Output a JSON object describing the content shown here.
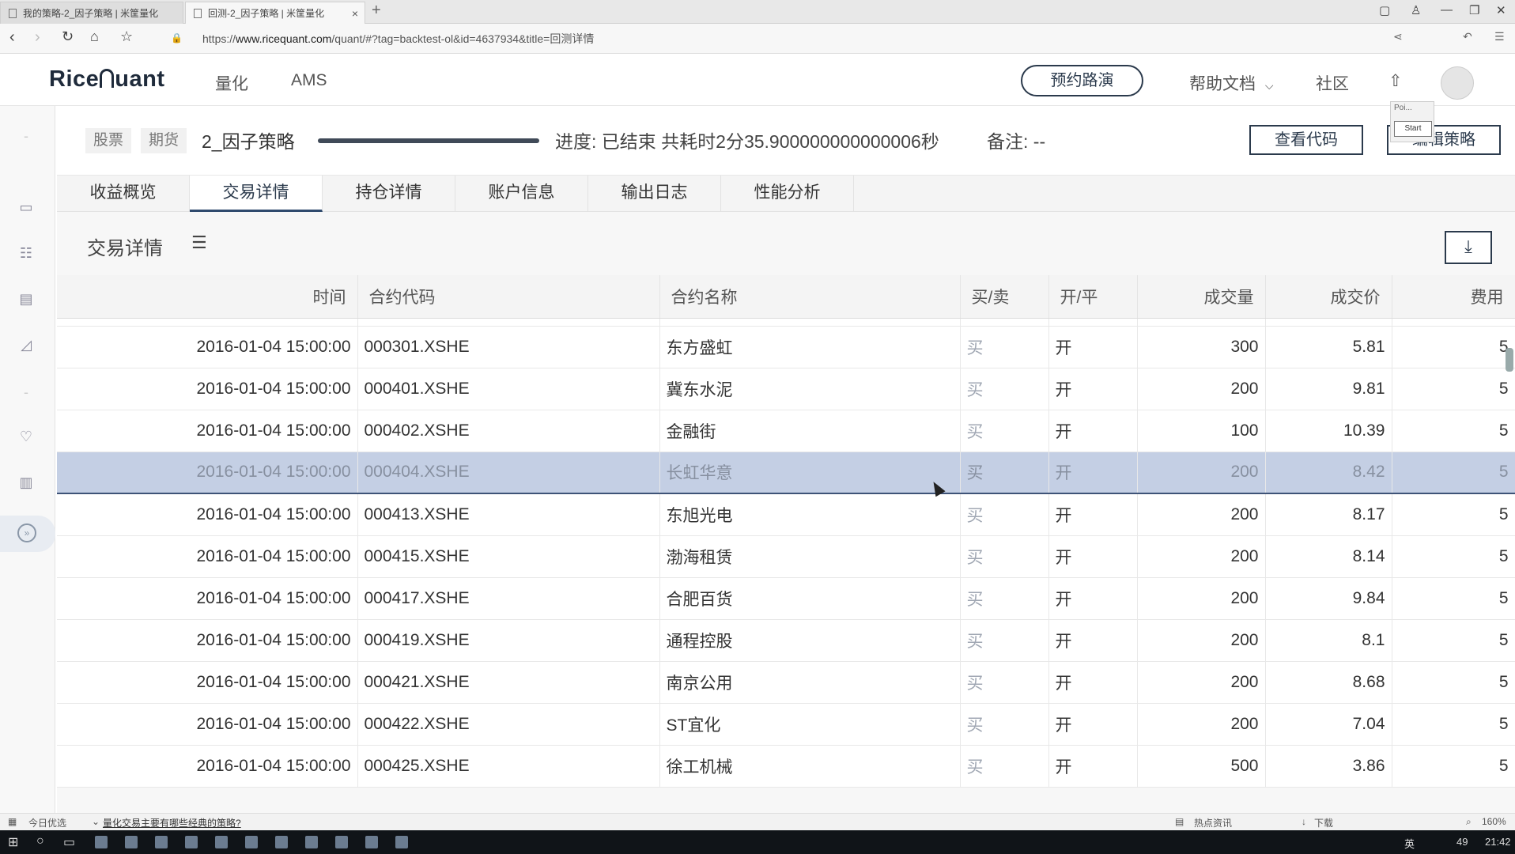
{
  "browser": {
    "tabs": [
      {
        "label": "我的策略-2_因子策略 | 米筐量化",
        "active": false
      },
      {
        "label": "回测-2_因子策略 | 米筐量化",
        "active": true
      }
    ],
    "url_prefix": "https://",
    "url_host": "www.ricequant.com",
    "url_path": "/quant/#?tag=backtest-ol&id=4637934&title=回测详情",
    "zoom": "160%"
  },
  "site": {
    "logo_left": "Rice",
    "logo_right": "uant",
    "menu": [
      "量化",
      "AMS"
    ],
    "demo_label": "预约路演",
    "help_label": "帮助文档",
    "community_label": "社区"
  },
  "strategy": {
    "tags": [
      "股票",
      "期货"
    ],
    "name": "2_因子策略",
    "progress_fraction": 1.0,
    "progress_text": "进度: 已结束 共耗时2分35.900000000000006秒",
    "remark_text": "备注: --",
    "view_code_label": "查看代码",
    "edit_label": "编辑策略"
  },
  "popup": {
    "text": "Poi...",
    "start_label": "Start"
  },
  "section_tabs": [
    "收益概览",
    "交易详情",
    "持仓详情",
    "账户信息",
    "输出日志",
    "性能分析"
  ],
  "active_tab_index": 1,
  "panel": {
    "title": "交易详情"
  },
  "table": {
    "columns": [
      "时间",
      "合约代码",
      "合约名称",
      "买/卖",
      "开/平",
      "成交量",
      "成交价",
      "费用"
    ],
    "rows": [
      [
        "2016-01-04 15:00:00",
        "000301.XSHE",
        "东方盛虹",
        "买",
        "开",
        "300",
        "5.81",
        "5"
      ],
      [
        "2016-01-04 15:00:00",
        "000401.XSHE",
        "冀东水泥",
        "买",
        "开",
        "200",
        "9.81",
        "5"
      ],
      [
        "2016-01-04 15:00:00",
        "000402.XSHE",
        "金融街",
        "买",
        "开",
        "100",
        "10.39",
        "5"
      ],
      [
        "2016-01-04 15:00:00",
        "000404.XSHE",
        "长虹华意",
        "买",
        "开",
        "200",
        "8.42",
        "5"
      ],
      [
        "2016-01-04 15:00:00",
        "000413.XSHE",
        "东旭光电",
        "买",
        "开",
        "200",
        "8.17",
        "5"
      ],
      [
        "2016-01-04 15:00:00",
        "000415.XSHE",
        "渤海租赁",
        "买",
        "开",
        "200",
        "8.14",
        "5"
      ],
      [
        "2016-01-04 15:00:00",
        "000417.XSHE",
        "合肥百货",
        "买",
        "开",
        "200",
        "9.84",
        "5"
      ],
      [
        "2016-01-04 15:00:00",
        "000419.XSHE",
        "通程控股",
        "买",
        "开",
        "200",
        "8.1",
        "5"
      ],
      [
        "2016-01-04 15:00:00",
        "000421.XSHE",
        "南京公用",
        "买",
        "开",
        "200",
        "8.68",
        "5"
      ],
      [
        "2016-01-04 15:00:00",
        "000422.XSHE",
        "ST宜化",
        "买",
        "开",
        "200",
        "7.04",
        "5"
      ],
      [
        "2016-01-04 15:00:00",
        "000425.XSHE",
        "徐工机械",
        "买",
        "开",
        "500",
        "3.86",
        "5"
      ]
    ],
    "highlighted_row": 3
  },
  "statusbar": {
    "left_label": "今日优选",
    "link_label": "量化交易主要有哪些经典的策略?",
    "news_label": "热点资讯",
    "download_label": "下载"
  },
  "taskbar": {
    "lang": "英",
    "badge": "49",
    "time": "21:42"
  }
}
